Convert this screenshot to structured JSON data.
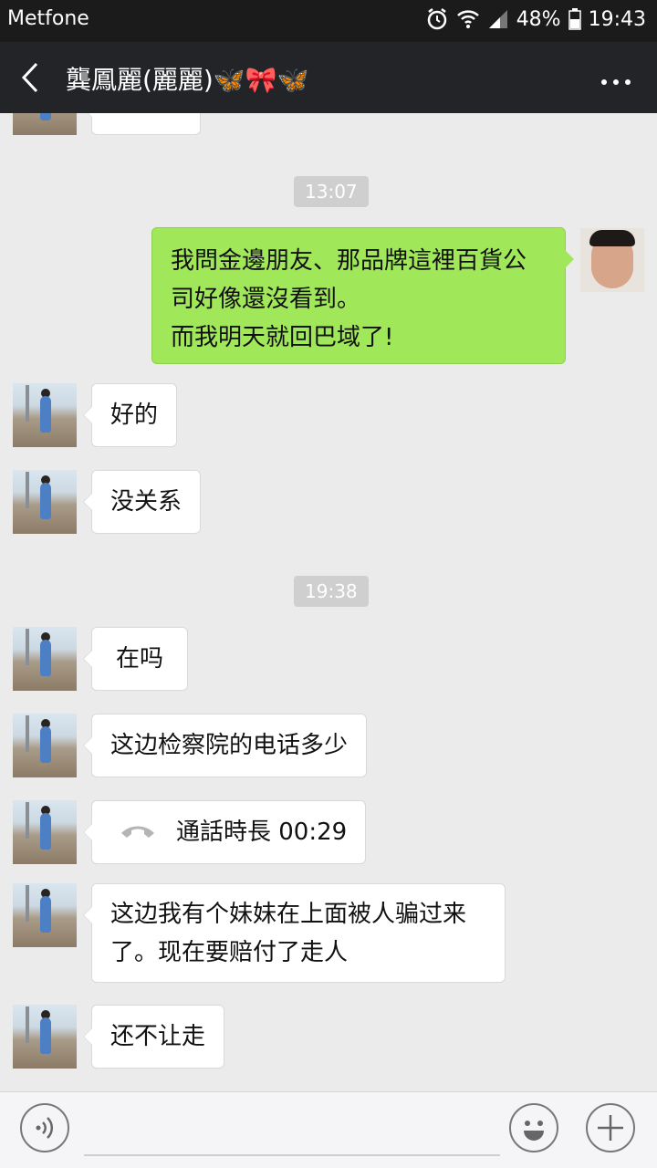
{
  "status_bar": {
    "carrier": "Metfone",
    "battery": "48%",
    "time": "19:43"
  },
  "header": {
    "title": "龔鳳麗(麗麗)🦋🎀🦋"
  },
  "messages": {
    "t1": "13:07",
    "m1": "我問金邊朋友、那品牌這裡百貨公司好像還沒看到。\n而我明天就回巴域了!",
    "m2": "好的",
    "m3": "没关系",
    "t2": "19:38",
    "m4": "在吗",
    "m5": "这边检察院的电话多少",
    "m6": "通話時長 00:29",
    "m7": "这边我有个妹妹在上面被人骗过来了。现在要赔付了走人",
    "m8": "还不让走"
  },
  "input_bar": {
    "placeholder": ""
  },
  "colors": {
    "sent_bubble": "#a0e75a",
    "received_bubble": "#ffffff",
    "header_bg": "#222428",
    "chat_bg": "#ebebeb"
  }
}
